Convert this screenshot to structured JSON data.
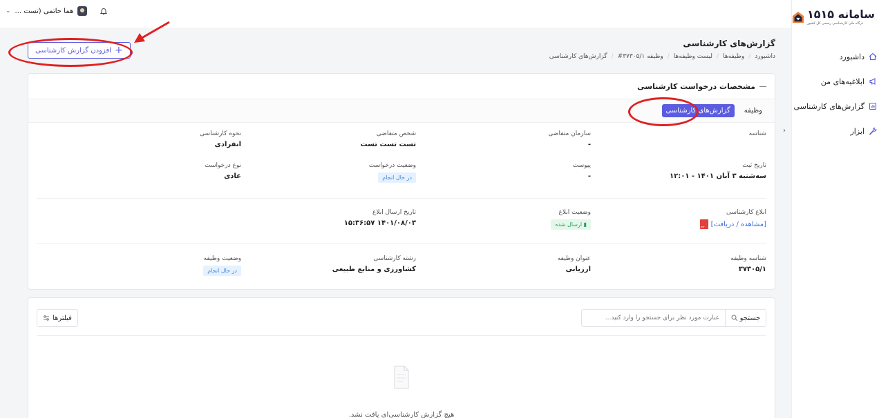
{
  "brand": {
    "name": "سامانه ۱۵۱۵",
    "subtitle": "درگاه ملی کارشناسی رسمی کل کشور"
  },
  "sidebar": {
    "items": [
      {
        "label": "داشبورد",
        "icon": "home-icon"
      },
      {
        "label": "ابلاغیه‌های من",
        "icon": "megaphone-icon"
      },
      {
        "label": "گزارش‌های کارشناسی",
        "icon": "report-icon"
      },
      {
        "label": "ابزار",
        "icon": "tool-icon"
      }
    ]
  },
  "topbar": {
    "user_name": "هما حاتمی (تست ..."
  },
  "page": {
    "title": "گزارش‌های کارشناسی",
    "breadcrumb": [
      "داشبورد",
      "وظیفه‌ها",
      "لیست وظیفه‌ها",
      "وظیفه ۳۷۳۰۵/۱#",
      "گزارش‌های کارشناسی"
    ],
    "add_button": "افزودن گزارش کارشناسی"
  },
  "details": {
    "header": "مشخصات درخواست کارشناسی",
    "tabs": [
      "وظیفه",
      "گزارش‌های کارشناسی"
    ],
    "row1": [
      {
        "label": "شناسه",
        "value": ""
      },
      {
        "label": "سازمان متقاضی",
        "value": "-"
      },
      {
        "label": "شخص متقاضی",
        "value": "تست تست تست"
      },
      {
        "label": "نحوه کارشناسی",
        "value": "انفرادی"
      }
    ],
    "row2": [
      {
        "label": "تاریخ ثبت",
        "value": "سه‌شنبه ۳ آبان ۱۴۰۱ - ۱۲:۰۱"
      },
      {
        "label": "پیوست",
        "value": "-"
      },
      {
        "label": "وضعیت درخواست",
        "value": "در حال انجام"
      },
      {
        "label": "نوع درخواست",
        "value": "عادی"
      }
    ],
    "row3": [
      {
        "label": "ابلاغ کارشناسی",
        "value": "[مشاهده / دریافت]"
      },
      {
        "label": "وضعیت ابلاغ",
        "value": "ارسال شده"
      },
      {
        "label": "تاریخ ارسال ابلاغ",
        "value": "۱۴۰۱/۰۸/۰۳ ۱۵:۳۶:۵۷"
      }
    ],
    "row4": [
      {
        "label": "شناسه وظیفه",
        "value": "۳۷۳۰۵/۱"
      },
      {
        "label": "عنوان وظیفه",
        "value": "ارزیابی"
      },
      {
        "label": "رشته کارشناسی",
        "value": "کشاورزی و منابع طبیعی"
      },
      {
        "label": "وضعیت وظیفه",
        "value": "در حال انجام"
      }
    ]
  },
  "list": {
    "search_placeholder": "عبارت مورد نظر برای جستجو را وارد کنید...",
    "search_button": "جستجو",
    "filter_button": "فیلترها",
    "empty_text": "هیچ گزارش کارشناسی‌ای یافت نشد."
  },
  "colors": {
    "primary": "#5b5ce0",
    "annotation": "#e02020"
  }
}
